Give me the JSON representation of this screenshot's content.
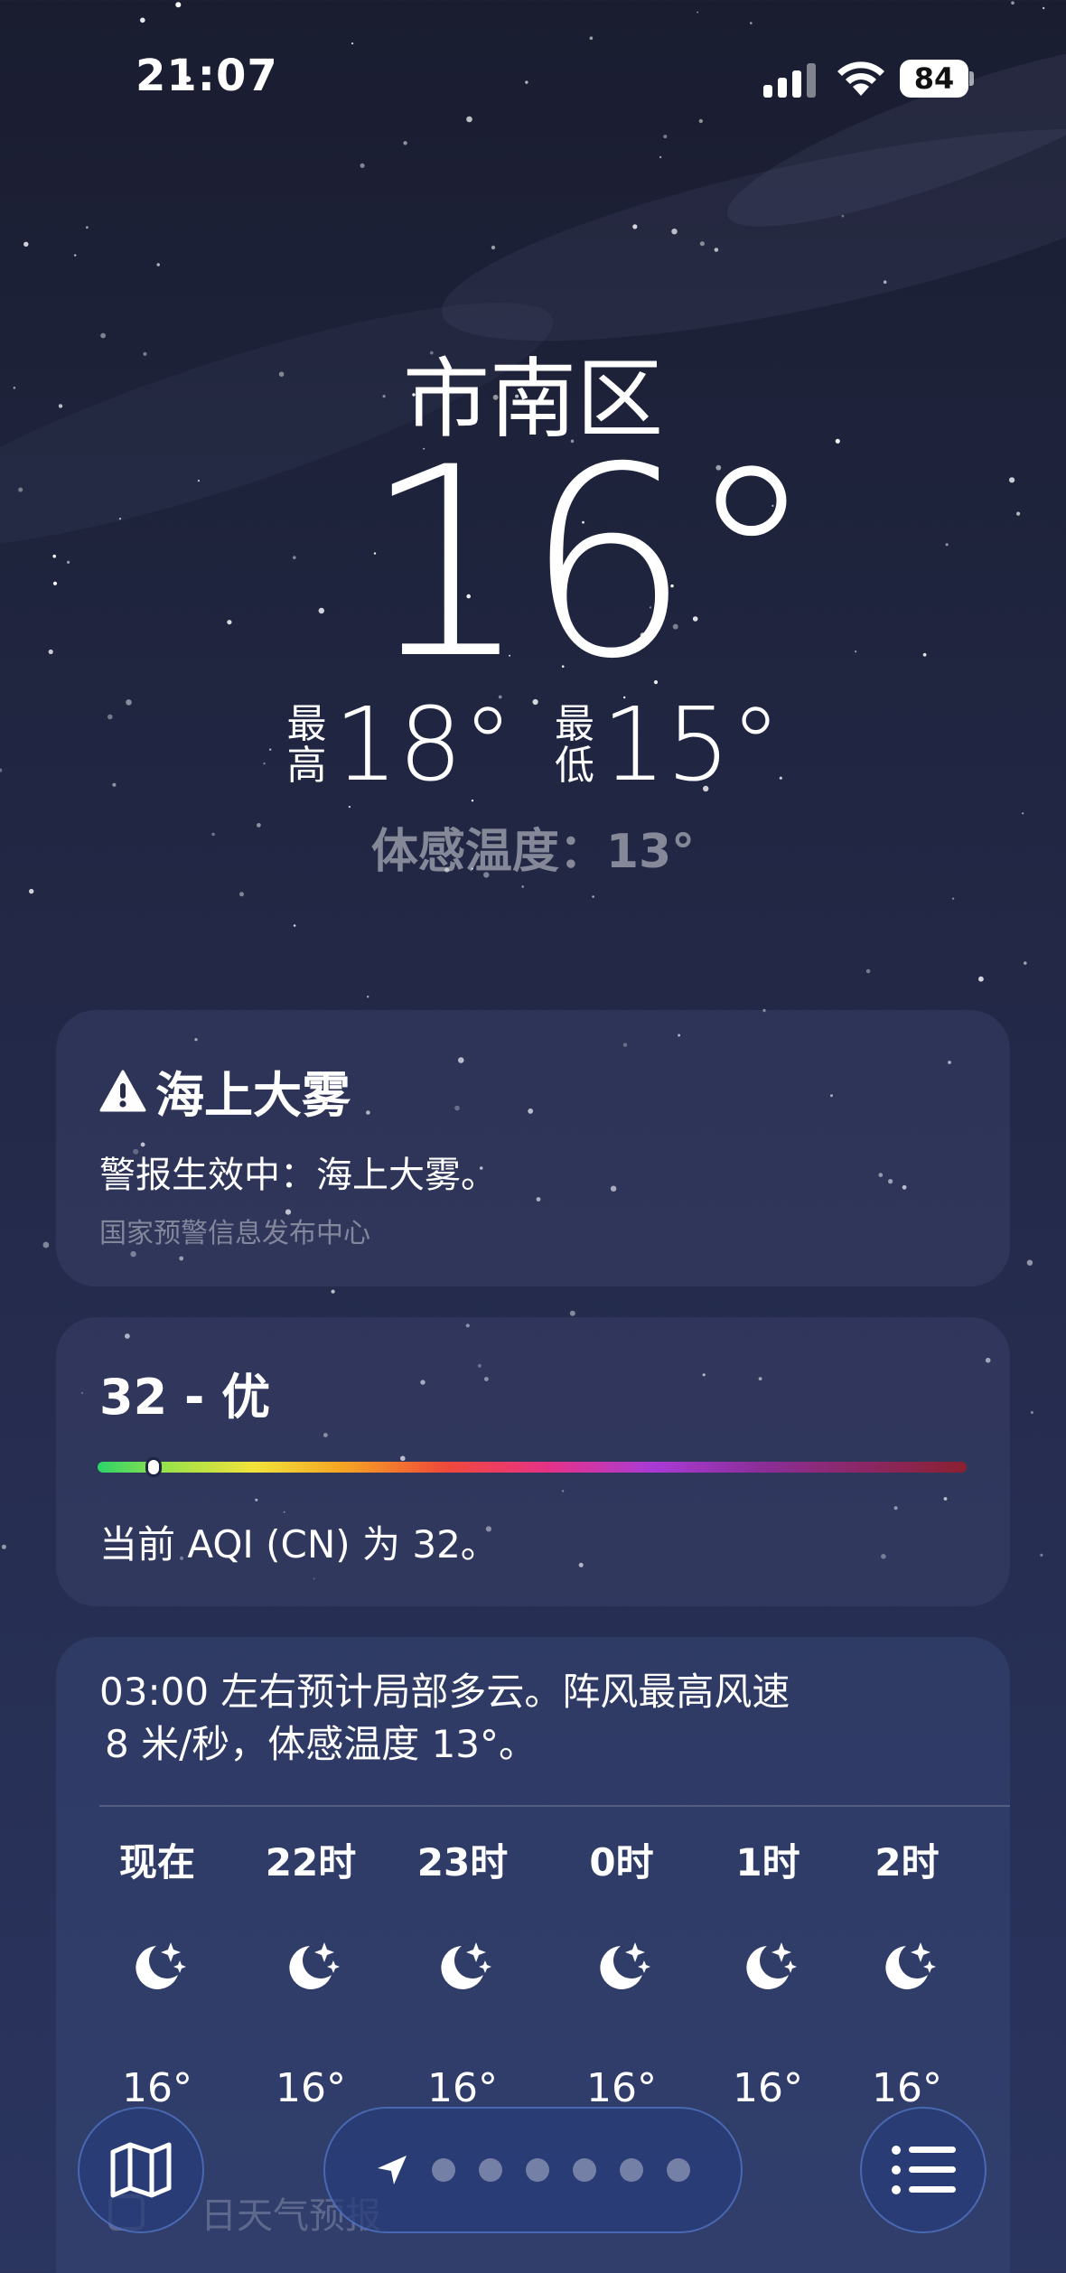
{
  "status_bar": {
    "time": "21:07",
    "battery_level": "84",
    "icons": [
      "cellular-signal-icon",
      "wifi-icon",
      "battery-icon"
    ]
  },
  "hero": {
    "city": "市南区",
    "temperature": "16°",
    "high_label": "最高",
    "high_value": "18°",
    "low_label": "最低",
    "low_value": "15°",
    "feels_like": "体感温度：13°"
  },
  "alert": {
    "icon": "warning-triangle-icon",
    "title": "海上大雾",
    "body": "警报生效中：海上大雾。",
    "source": "国家预警信息发布中心"
  },
  "aqi": {
    "title": "32 - 优",
    "value": 32,
    "scale_max": 500,
    "description": "当前 AQI (CN) 为 32。"
  },
  "hourly": {
    "summary_line1": "03:00 左右预计局部多云。阵风最高风速",
    "summary_line2": "8 米/秒，体感温度 13°。",
    "items": [
      {
        "time": "现在",
        "icon": "moon-stars-icon",
        "temp": "16°"
      },
      {
        "time": "22时",
        "icon": "moon-stars-icon",
        "temp": "16°"
      },
      {
        "time": "23时",
        "icon": "moon-stars-icon",
        "temp": "16°"
      },
      {
        "time": "0时",
        "icon": "moon-stars-icon",
        "temp": "16°"
      },
      {
        "time": "1时",
        "icon": "moon-stars-icon",
        "temp": "16°"
      },
      {
        "time": "2时",
        "icon": "moon-stars-icon",
        "temp": "16°"
      }
    ]
  },
  "daily_peek": "日天气预报",
  "dock": {
    "left_icon": "map-icon",
    "center_icon": "location-arrow-icon",
    "page_dots": 6,
    "right_icon": "list-icon"
  }
}
